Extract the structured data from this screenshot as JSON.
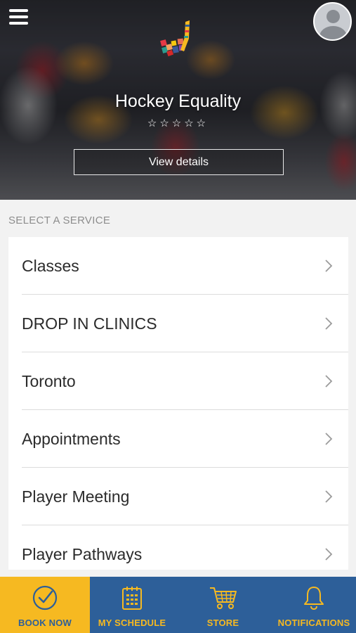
{
  "header": {
    "org_name": "Hockey Equality",
    "rating_stars": "☆☆☆☆☆",
    "rating_value": 0,
    "view_details_label": "View details",
    "menu_icon": "hamburger-menu-icon",
    "avatar_icon": "user-avatar-icon"
  },
  "services": {
    "section_title": "SELECT A SERVICE",
    "items": [
      {
        "label": "Classes"
      },
      {
        "label": "DROP IN CLINICS"
      },
      {
        "label": "Toronto"
      },
      {
        "label": "Appointments"
      },
      {
        "label": "Player Meeting"
      },
      {
        "label": "Player Pathways"
      }
    ]
  },
  "bottom_nav": {
    "items": [
      {
        "label": "BOOK NOW",
        "icon": "check-circle-icon",
        "active": true
      },
      {
        "label": "MY SCHEDULE",
        "icon": "calendar-icon",
        "active": false
      },
      {
        "label": "STORE",
        "icon": "cart-icon",
        "active": false
      },
      {
        "label": "NOTIFICATIONS",
        "icon": "bell-icon",
        "active": false
      }
    ]
  },
  "colors": {
    "nav_blue": "#2d5f99",
    "accent_yellow": "#f6b921",
    "section_gray": "#f2f2f2"
  }
}
